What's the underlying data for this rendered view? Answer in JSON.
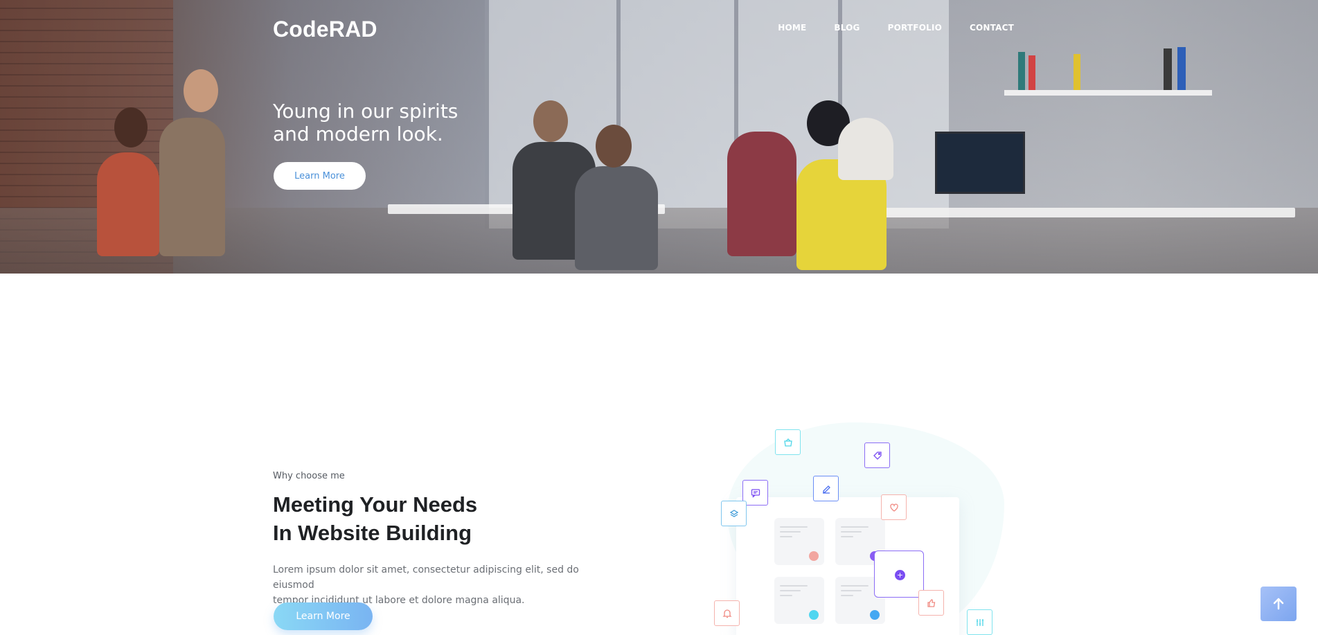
{
  "nav": {
    "logo": "CodeRAD",
    "items": [
      "HOME",
      "BLOG",
      "PORTFOLIO",
      "CONTACT"
    ]
  },
  "hero": {
    "line1": "Young in our spirits",
    "line2": "and modern look.",
    "button_label": "Learn More"
  },
  "section": {
    "eyebrow": "Why choose me",
    "heading_line1": "Meeting Your Needs",
    "heading_line2": "In Website Building",
    "paragraph_line1": "Lorem ipsum dolor sit amet, consectetur adipiscing elit, sed do eiusmod",
    "paragraph_line2": "tempor incididunt ut labore et dolore magna aliqua.",
    "button_label": "Learn More"
  },
  "illustration": {
    "icons": [
      "basket-icon",
      "tag-icon",
      "chat-icon",
      "edit-icon",
      "heart-icon",
      "layers-icon",
      "bell-icon",
      "thumbs-up-icon",
      "sliders-icon"
    ],
    "card_dot_colors": [
      "#f2a6a0",
      "#8a5cf3",
      "#4fd6f0",
      "#45a8f2"
    ],
    "plus_symbol": "+"
  },
  "colors": {
    "accent_blue": "#4a90d9",
    "cta_gradient_start": "#8ad8f5",
    "cta_gradient_end": "#79b4f2",
    "purple": "#7a4df2",
    "heading": "#1f2124"
  }
}
